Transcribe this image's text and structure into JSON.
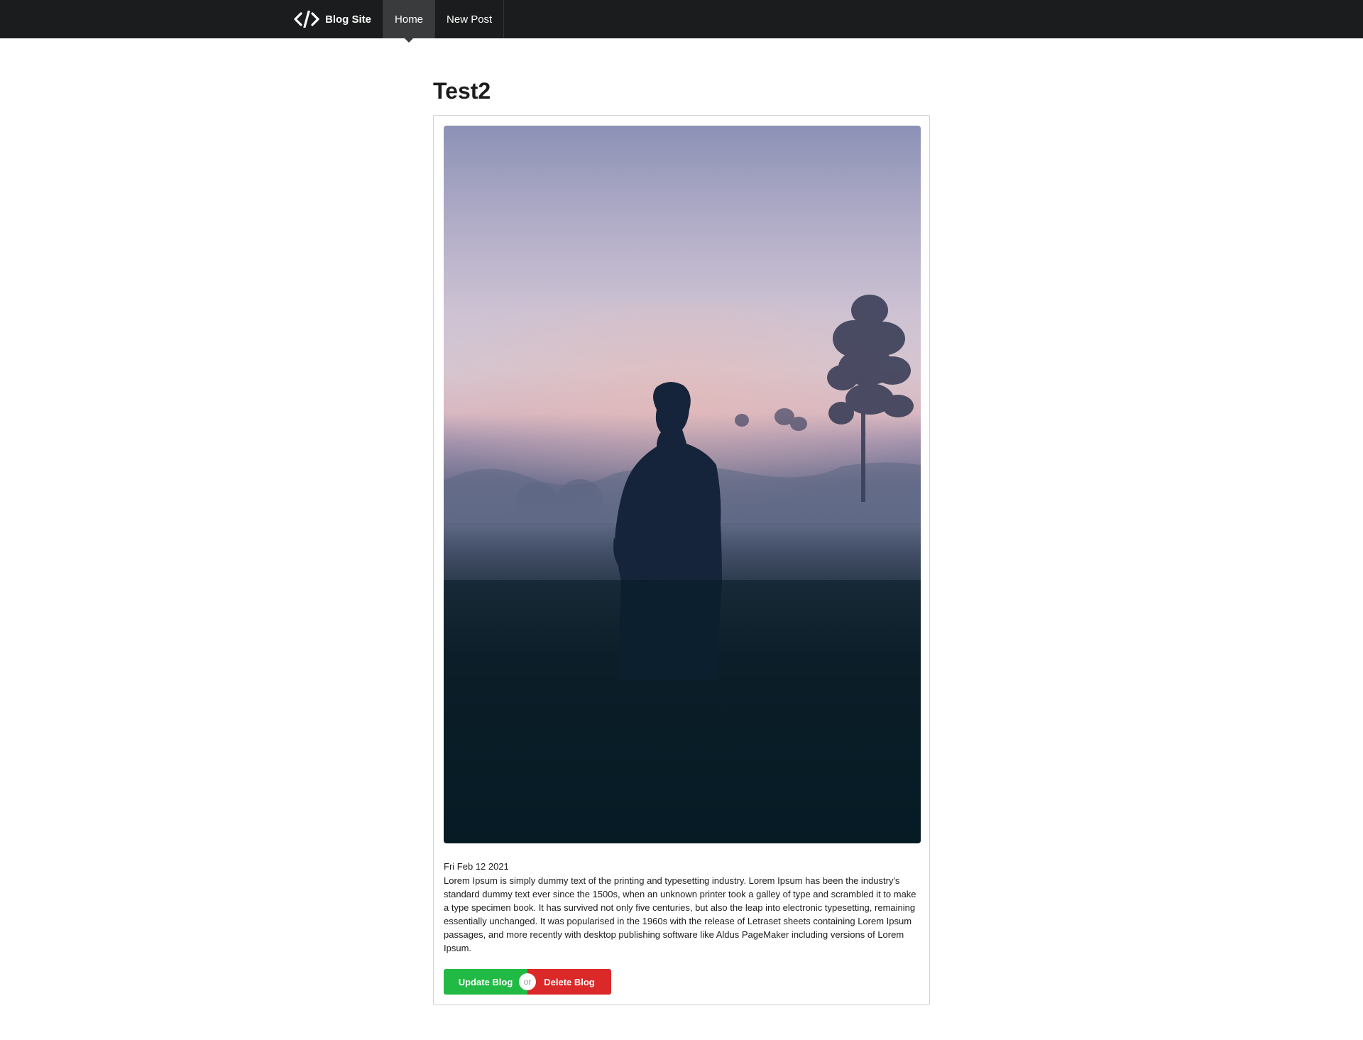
{
  "nav": {
    "brand_icon": "code-icon",
    "brand_label": "Blog Site",
    "items": [
      {
        "label": "Home",
        "active": true
      },
      {
        "label": "New Post",
        "active": false
      }
    ]
  },
  "post": {
    "title": "Test2",
    "image": {
      "description_icon": "photo-silhouette-misty-dusk"
    },
    "date": "Fri Feb 12 2021",
    "body": "Lorem Ipsum is simply dummy text of the printing and typesetting industry. Lorem Ipsum has been the industry's standard dummy text ever since the 1500s, when an unknown printer took a galley of type and scrambled it to make a type specimen book. It has survived not only five centuries, but also the leap into electronic typesetting, remaining essentially unchanged. It was popularised in the 1960s with the release of Letraset sheets containing Lorem Ipsum passages, and more recently with desktop publishing software like Aldus PageMaker including versions of Lorem Ipsum."
  },
  "actions": {
    "update_label": "Update Blog",
    "or_label": "or",
    "delete_label": "Delete Blog"
  },
  "colors": {
    "nav_bg": "#1b1c1d",
    "nav_active": "#3a3b3d",
    "update": "#21ba45",
    "delete": "#db2828"
  }
}
